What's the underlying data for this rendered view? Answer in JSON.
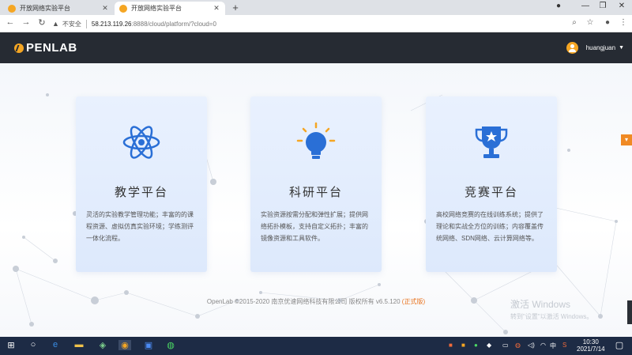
{
  "browser": {
    "tabs": [
      {
        "title": "开放网络实验平台",
        "active": false
      },
      {
        "title": "开放网络实验平台",
        "active": true
      }
    ],
    "new_tab": "+",
    "security_label": "不安全",
    "url_host": "58.213.119.26",
    "url_rest": ":8888/cloud/platform/?cloud=0"
  },
  "header": {
    "logo_text": "PENLAB",
    "username": "huangjuan"
  },
  "cards": [
    {
      "title": "教学平台",
      "description": "灵活的实验教学管理功能；丰富的的课程资源、虚拟仿真实验环境；学练测评一体化流程。",
      "icon": "atom-icon"
    },
    {
      "title": "科研平台",
      "description": "实验资源按需分配和弹性扩展；提供网络拓扑模板，支持自定义拓扑；丰富的镜像资源和工具软件。",
      "icon": "lightbulb-icon"
    },
    {
      "title": "竞赛平台",
      "description": "高校网络竞赛的在线训练系统；提供了理论和实战全方位的训练；内容覆盖传统网络、SDN网络、云计算网络等。",
      "icon": "trophy-icon"
    }
  ],
  "footer": {
    "copyright": "OpenLab ©2015-2020 南京优速网络科技有限公司 版权所有  v6.5.120",
    "release": "(正式版)"
  },
  "watermark": {
    "line1": "激活 Windows",
    "line2": "转到\"设置\"以激活 Windows。"
  },
  "taskbar": {
    "time": "10:30",
    "date": "2021/7/14",
    "ime": "中"
  },
  "colors": {
    "accent": "#f5a623",
    "header_bg": "#262b33",
    "card_icon": "#2a6fd6"
  }
}
